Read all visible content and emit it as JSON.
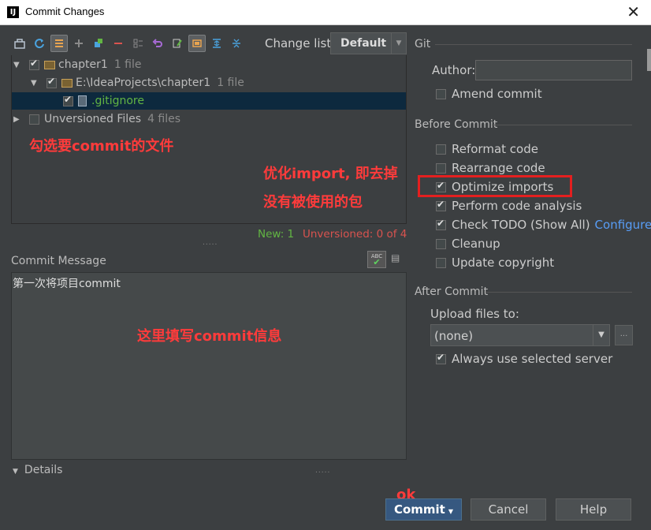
{
  "window": {
    "title": "Commit Changes",
    "app_icon": "IJ",
    "close_glyph": "✕"
  },
  "toolbar": {
    "icons": [
      "diff-icon",
      "refresh-icon",
      "group-icon",
      "add-icon",
      "move-icon",
      "remove-icon",
      "shelve-icon",
      "revert-icon",
      "edit-icon",
      "preview-icon",
      "expand-icon",
      "collapse-icon"
    ],
    "changelist_label": "Change list:",
    "changelist_value": "Default"
  },
  "tree": {
    "rows": [
      {
        "label": "chapter1",
        "count": "1 file"
      },
      {
        "label": "E:\\IdeaProjects\\chapter1",
        "count": "1 file"
      },
      {
        "label": ".gitignore"
      },
      {
        "label": "Unversioned Files",
        "count": "4 files"
      }
    ],
    "stats_new": "New: 1",
    "stats_unversioned": "Unversioned: 0 of 4"
  },
  "annotations": {
    "select_files": "勾选要commit的文件",
    "optimize_line1": "优化import, 即去掉",
    "optimize_line2": "没有被使用的包",
    "fill_message": "这里填写commit信息",
    "ok": "ok"
  },
  "commit_message": {
    "label": "Commit Message",
    "value": "第一次将项目commit",
    "spell_label": "ABC"
  },
  "details": {
    "label": "Details"
  },
  "git": {
    "title": "Git",
    "author_label": "Author:",
    "author_value": "",
    "amend_label": "Amend commit"
  },
  "before_commit": {
    "title": "Before Commit",
    "options": [
      {
        "label": "Reformat code",
        "checked": false
      },
      {
        "label": "Rearrange code",
        "checked": false
      },
      {
        "label": "Optimize imports",
        "checked": true
      },
      {
        "label": "Perform code analysis",
        "checked": true
      },
      {
        "label": "Check TODO (Show All)",
        "checked": true
      },
      {
        "label": "Cleanup",
        "checked": false
      },
      {
        "label": "Update copyright",
        "checked": false
      }
    ],
    "configure_link": "Configure"
  },
  "after_commit": {
    "title": "After Commit",
    "upload_label": "Upload files to:",
    "upload_value": "(none)",
    "more_label": "...",
    "always_label": "Always use selected server"
  },
  "buttons": {
    "commit": "Commit",
    "cancel": "Cancel",
    "help": "Help"
  },
  "colors": {
    "background": "#3c3f41",
    "primary_button": "#365880",
    "selection": "#0d293e",
    "annotation": "#ff3b3b",
    "link": "#589df6"
  }
}
